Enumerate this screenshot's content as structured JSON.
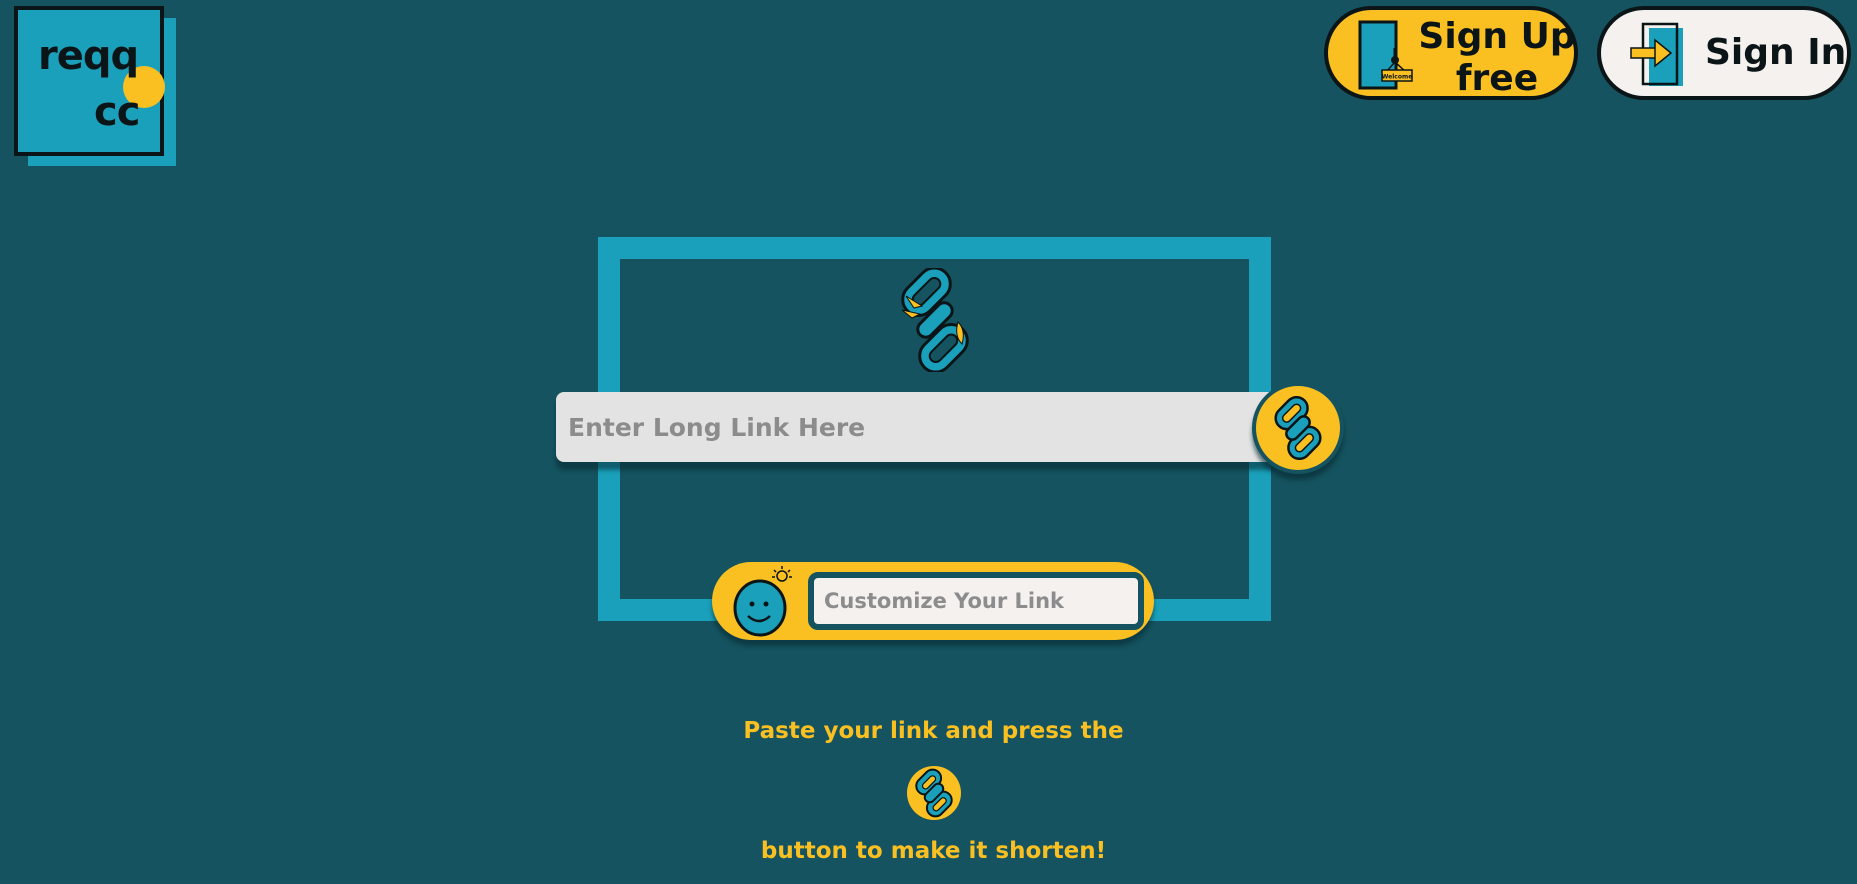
{
  "brand": {
    "logo_line1": "reqq",
    "logo_line2": "cc"
  },
  "header": {
    "signup_label": "Sign Up free",
    "signin_label": "Sign In",
    "door_sign_text": "Welcome"
  },
  "shortener": {
    "long_link_placeholder": "Enter Long Link Here",
    "long_link_value": "",
    "custom_link_placeholder": "Customize Your Link",
    "custom_link_value": ""
  },
  "instructions": {
    "line1": "Paste your link and press the",
    "line2": "button to make it shorten!"
  },
  "colors": {
    "background": "#14535f",
    "accent_cyan": "#1aa0ba",
    "accent_yellow": "#fac022",
    "ink": "#0b1416",
    "input_bg": "#e3e3e3"
  },
  "icons": {
    "hero": "chain-link-icon",
    "shorten": "chain-link-icon",
    "custom": "smiley-idea-icon",
    "signup": "door-welcome-icon",
    "signin": "enter-door-icon"
  }
}
